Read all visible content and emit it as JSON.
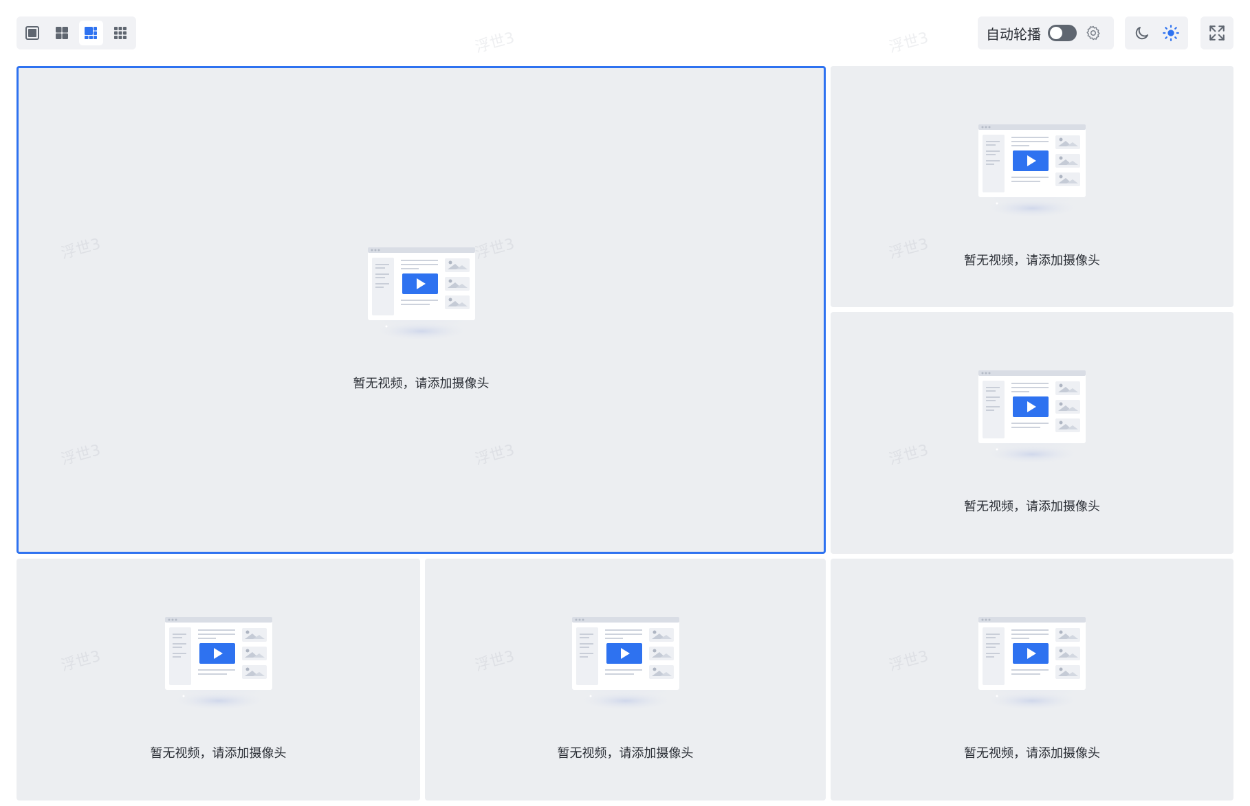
{
  "toolbar": {
    "layouts": [
      {
        "name": "layout-1x1",
        "active": false
      },
      {
        "name": "layout-2x2",
        "active": false
      },
      {
        "name": "layout-1plus5",
        "active": true
      },
      {
        "name": "layout-3x3",
        "active": false
      }
    ],
    "autoplay_label": "自动轮播",
    "autoplay_on": false
  },
  "watermark_text": "浮世3",
  "cells": [
    {
      "empty_text": "暂无视频，请添加摄像头"
    },
    {
      "empty_text": "暂无视频，请添加摄像头"
    },
    {
      "empty_text": "暂无视频，请添加摄像头"
    },
    {
      "empty_text": "暂无视频，请添加摄像头"
    },
    {
      "empty_text": "暂无视频，请添加摄像头"
    },
    {
      "empty_text": "暂无视频，请添加摄像头"
    }
  ],
  "colors": {
    "accent": "#2e72f0",
    "cell_bg": "#eceef1",
    "toolbar_bg": "#f1f2f5",
    "text": "#2b2f36"
  },
  "icons": {
    "autoplay_settings": "gear-icon",
    "theme_dark": "moon-icon",
    "theme_light": "sun-icon",
    "fullscreen": "fullscreen-icon"
  }
}
